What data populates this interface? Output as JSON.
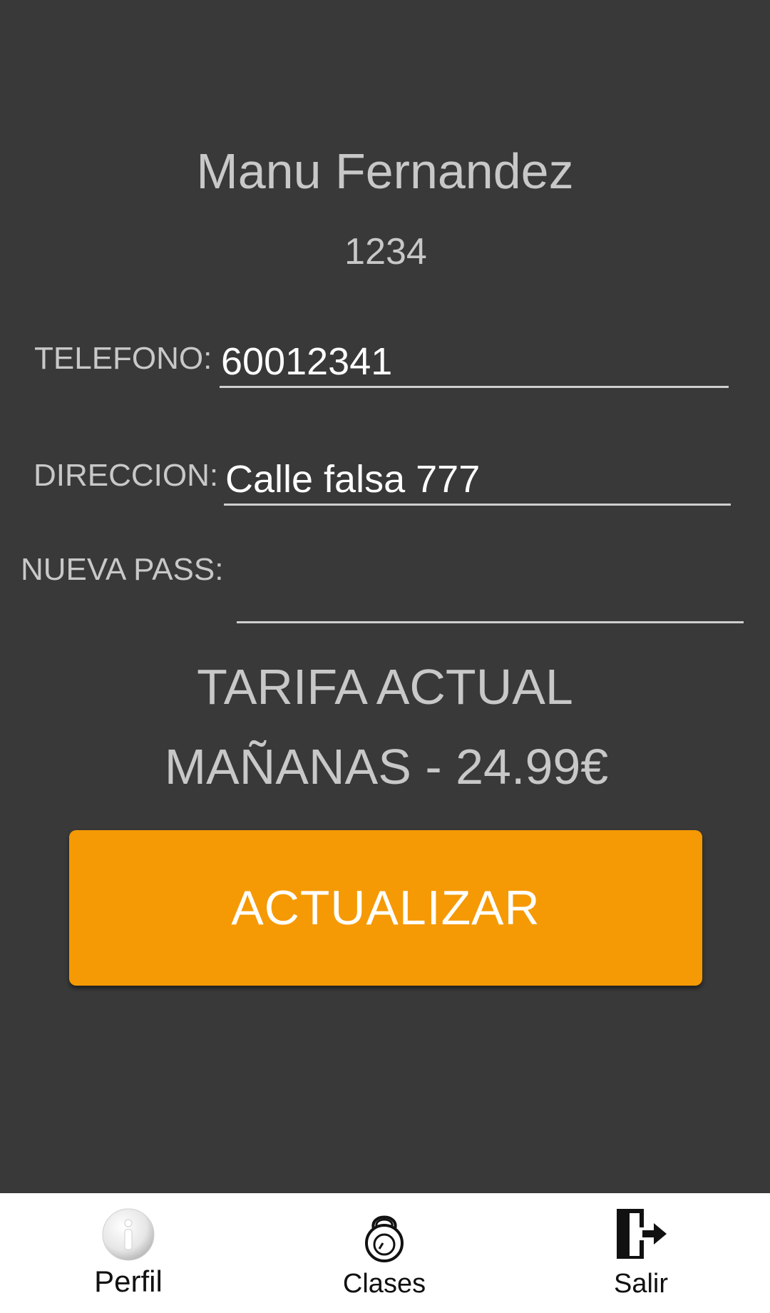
{
  "profile": {
    "name": "Manu Fernandez",
    "code": "1234"
  },
  "form": {
    "telefono": {
      "label": "TELEFONO:",
      "value": "60012341"
    },
    "direccion": {
      "label": "DIRECCION:",
      "value": "Calle falsa 777"
    },
    "nueva_pass": {
      "label": "NUEVA PASS:",
      "value": ""
    }
  },
  "tariff": {
    "title": "TARIFA ACTUAL",
    "value": "MAÑANAS - 24.99€"
  },
  "actions": {
    "update_label": "ACTUALIZAR"
  },
  "bottom_nav": {
    "items": [
      {
        "label": "Perfil",
        "icon": "info-icon",
        "active": true
      },
      {
        "label": "Clases",
        "icon": "kettlebell-icon",
        "active": false
      },
      {
        "label": "Salir",
        "icon": "exit-door-icon",
        "active": false
      }
    ]
  },
  "colors": {
    "background": "#393939",
    "accent": "#f59a04",
    "text_muted": "#c8c8c8",
    "nav_background": "#ffffff"
  }
}
